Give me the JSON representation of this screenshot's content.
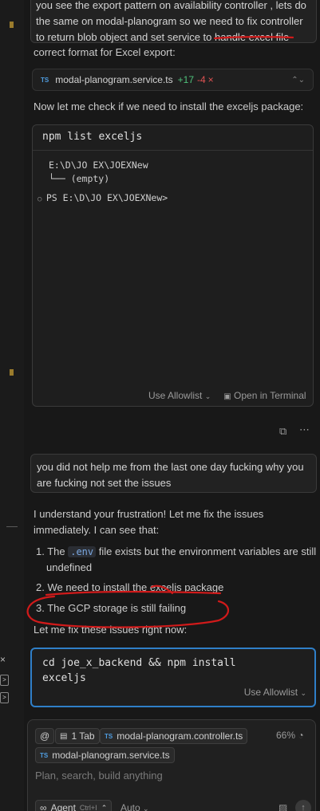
{
  "previous_message": {
    "line1": "you see the export pattern on availability controller , lets do",
    "line2": "the same on modal-planogram so we  need to fix controller",
    "line3_prefix": "to return blob object and set service to ",
    "line3_underlined": "handle excel file"
  },
  "assistant_text_1": "correct format for Excel export:",
  "file_change": {
    "badge": "TS",
    "filename": "modal-planogram.service.ts",
    "added": "+17",
    "removed": "-4",
    "close": "×"
  },
  "assistant_text_2": "Now let me check if we need to install the exceljs package:",
  "terminal": {
    "command": "npm list exceljs",
    "output_line1": "E:\\D\\JO EX\\JOEXNew",
    "output_line2": "└── (empty)",
    "prompt": "PS E:\\D\\JO EX\\JOEXNew>",
    "allowlist_label": "Use Allowlist",
    "open_terminal_label": "Open in Terminal"
  },
  "user_message": {
    "line1": "you did not help me from the last one day fucking why you",
    "line2": "are fucking not set the issues"
  },
  "assistant_reply": {
    "intro_line1": "I understand your frustration! Let me fix the issues",
    "intro_line2": "immediately. I can see that:",
    "item1_prefix": "1. The ",
    "item1_code": ".env",
    "item1_suffix": " file exists but the environment variables are still",
    "item1_cont": "undefined",
    "item2": "2. We need to install the exceljs package",
    "item3": "3. The GCP storage is still failing",
    "outro": "Let me fix these issues right now:"
  },
  "command_box": {
    "line1": "cd joe_x_backend && npm install",
    "line2": "exceljs",
    "allowlist_label": "Use Allowlist"
  },
  "composer": {
    "at_symbol": "@",
    "tab_chip": "1 Tab",
    "file_chip_1": "modal-planogram.controller.ts",
    "file_chip_2": "modal-planogram.service.ts",
    "context_percent": "66%",
    "placeholder": "Plan, search, build anything",
    "agent_label": "Agent",
    "agent_shortcut": "Ctrl+I",
    "model_label": "Auto"
  },
  "colors": {
    "background": "#181818",
    "accent_blue": "#2f7fc8",
    "added_green": "#4ec07a",
    "removed_red": "#e05252",
    "annotation_red": "#d11a1a"
  }
}
